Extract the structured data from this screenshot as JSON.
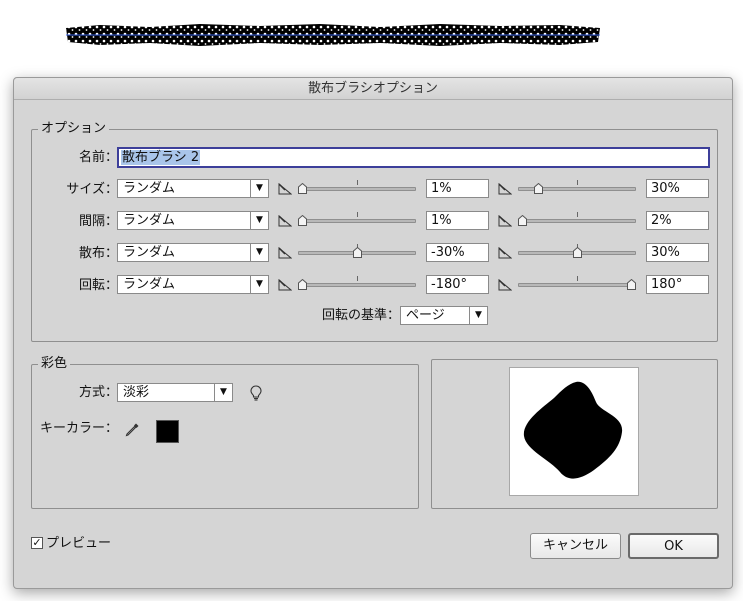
{
  "dialog": {
    "title": "散布ブラシオプション"
  },
  "options": {
    "group_label": "オプション",
    "name_label": "名前：",
    "name_value": "散布ブラシ 2",
    "rows": [
      {
        "label": "サイズ：",
        "mode": "ランダム",
        "min_value": "1%",
        "max_value": "30%",
        "min_fraction": 0.0,
        "max_fraction": 0.15
      },
      {
        "label": "間隔：",
        "mode": "ランダム",
        "min_value": "1%",
        "max_value": "2%",
        "min_fraction": 0.0,
        "max_fraction": 0.0
      },
      {
        "label": "散布：",
        "mode": "ランダム",
        "min_value": "-30%",
        "max_value": "30%",
        "min_fraction": 0.5,
        "max_fraction": 0.5
      },
      {
        "label": "回転：",
        "mode": "ランダム",
        "min_value": "-180°",
        "max_value": "180°",
        "min_fraction": 0.0,
        "max_fraction": 1.0
      }
    ],
    "rotation_base_label": "回転の基準：",
    "rotation_base_value": "ページ"
  },
  "color": {
    "group_label": "彩色",
    "method_label": "方式：",
    "method_value": "淡彩",
    "key_color_label": "キーカラー：",
    "key_color": "#000000"
  },
  "footer": {
    "preview_label": "プレビュー",
    "preview_checked": true,
    "cancel_label": "キャンセル",
    "ok_label": "OK"
  },
  "icons": {
    "tip": "lightbulb-icon",
    "eyedropper": "eyedropper-icon",
    "arrow": "chevron-down-icon"
  }
}
